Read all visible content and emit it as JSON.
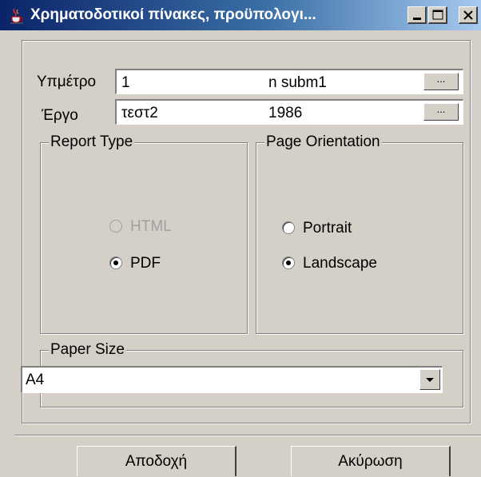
{
  "window": {
    "title": "Χρηματοδοτικοί πίνακες, προϋπολογι...",
    "icon": "java-cup-icon",
    "controls": [
      "minimize-icon",
      "maximize-icon",
      "close-icon"
    ]
  },
  "fields": {
    "ypometro": {
      "label": "Υπμέτρο",
      "value": "1",
      "secondary": "n subm1",
      "browse": "..."
    },
    "ergo": {
      "label": "Έργο",
      "value": "τεστ2",
      "secondary": "1986",
      "browse": "..."
    }
  },
  "report_type": {
    "title": "Report Type",
    "options": [
      {
        "label": "HTML",
        "selected": false,
        "enabled": false
      },
      {
        "label": "PDF",
        "selected": true,
        "enabled": true
      }
    ]
  },
  "page_orientation": {
    "title": "Page Orientation",
    "options": [
      {
        "label": "Portrait",
        "selected": false,
        "enabled": true
      },
      {
        "label": "Landscape",
        "selected": true,
        "enabled": true
      }
    ]
  },
  "paper_size": {
    "title": "Paper Size",
    "value": "A4"
  },
  "buttons": {
    "accept": "Αποδοχή",
    "cancel": "Ακύρωση"
  }
}
